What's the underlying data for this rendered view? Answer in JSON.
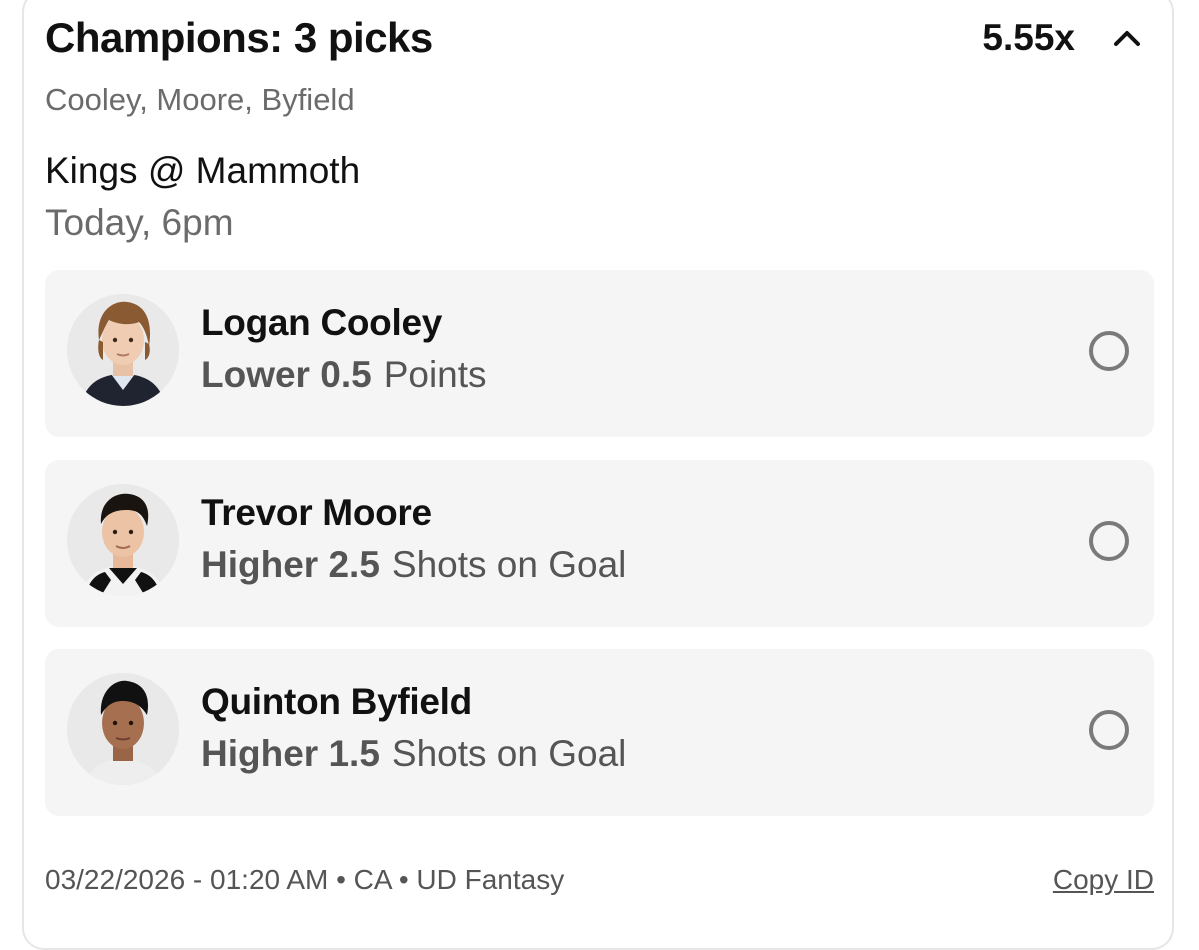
{
  "header": {
    "title": "Champions: 3 picks",
    "multiplier": "5.55x",
    "collapse_icon": "chevron-up-icon"
  },
  "subtitle": "Cooley, Moore, Byfield",
  "game": {
    "matchup": "Kings @ Mammoth",
    "time": "Today, 6pm"
  },
  "picks": [
    {
      "player": "Logan Cooley",
      "direction_line": "Lower 0.5",
      "stat": "Points",
      "avatar_icon": "player-headshot",
      "status_icon": "pending-circle-icon"
    },
    {
      "player": "Trevor Moore",
      "direction_line": "Higher 2.5",
      "stat": "Shots on Goal",
      "avatar_icon": "player-headshot",
      "status_icon": "pending-circle-icon"
    },
    {
      "player": "Quinton Byfield",
      "direction_line": "Higher 1.5",
      "stat": "Shots on Goal",
      "avatar_icon": "player-headshot",
      "status_icon": "pending-circle-icon"
    }
  ],
  "footer": {
    "meta": "03/22/2026 - 01:20 AM • CA • UD Fantasy",
    "copy_id_label": "Copy ID"
  },
  "colors": {
    "card_border": "#e6e6e6",
    "pick_background": "#f5f5f5",
    "secondary_text": "#6b6b6b",
    "radio_stroke": "#7a7a7a"
  }
}
